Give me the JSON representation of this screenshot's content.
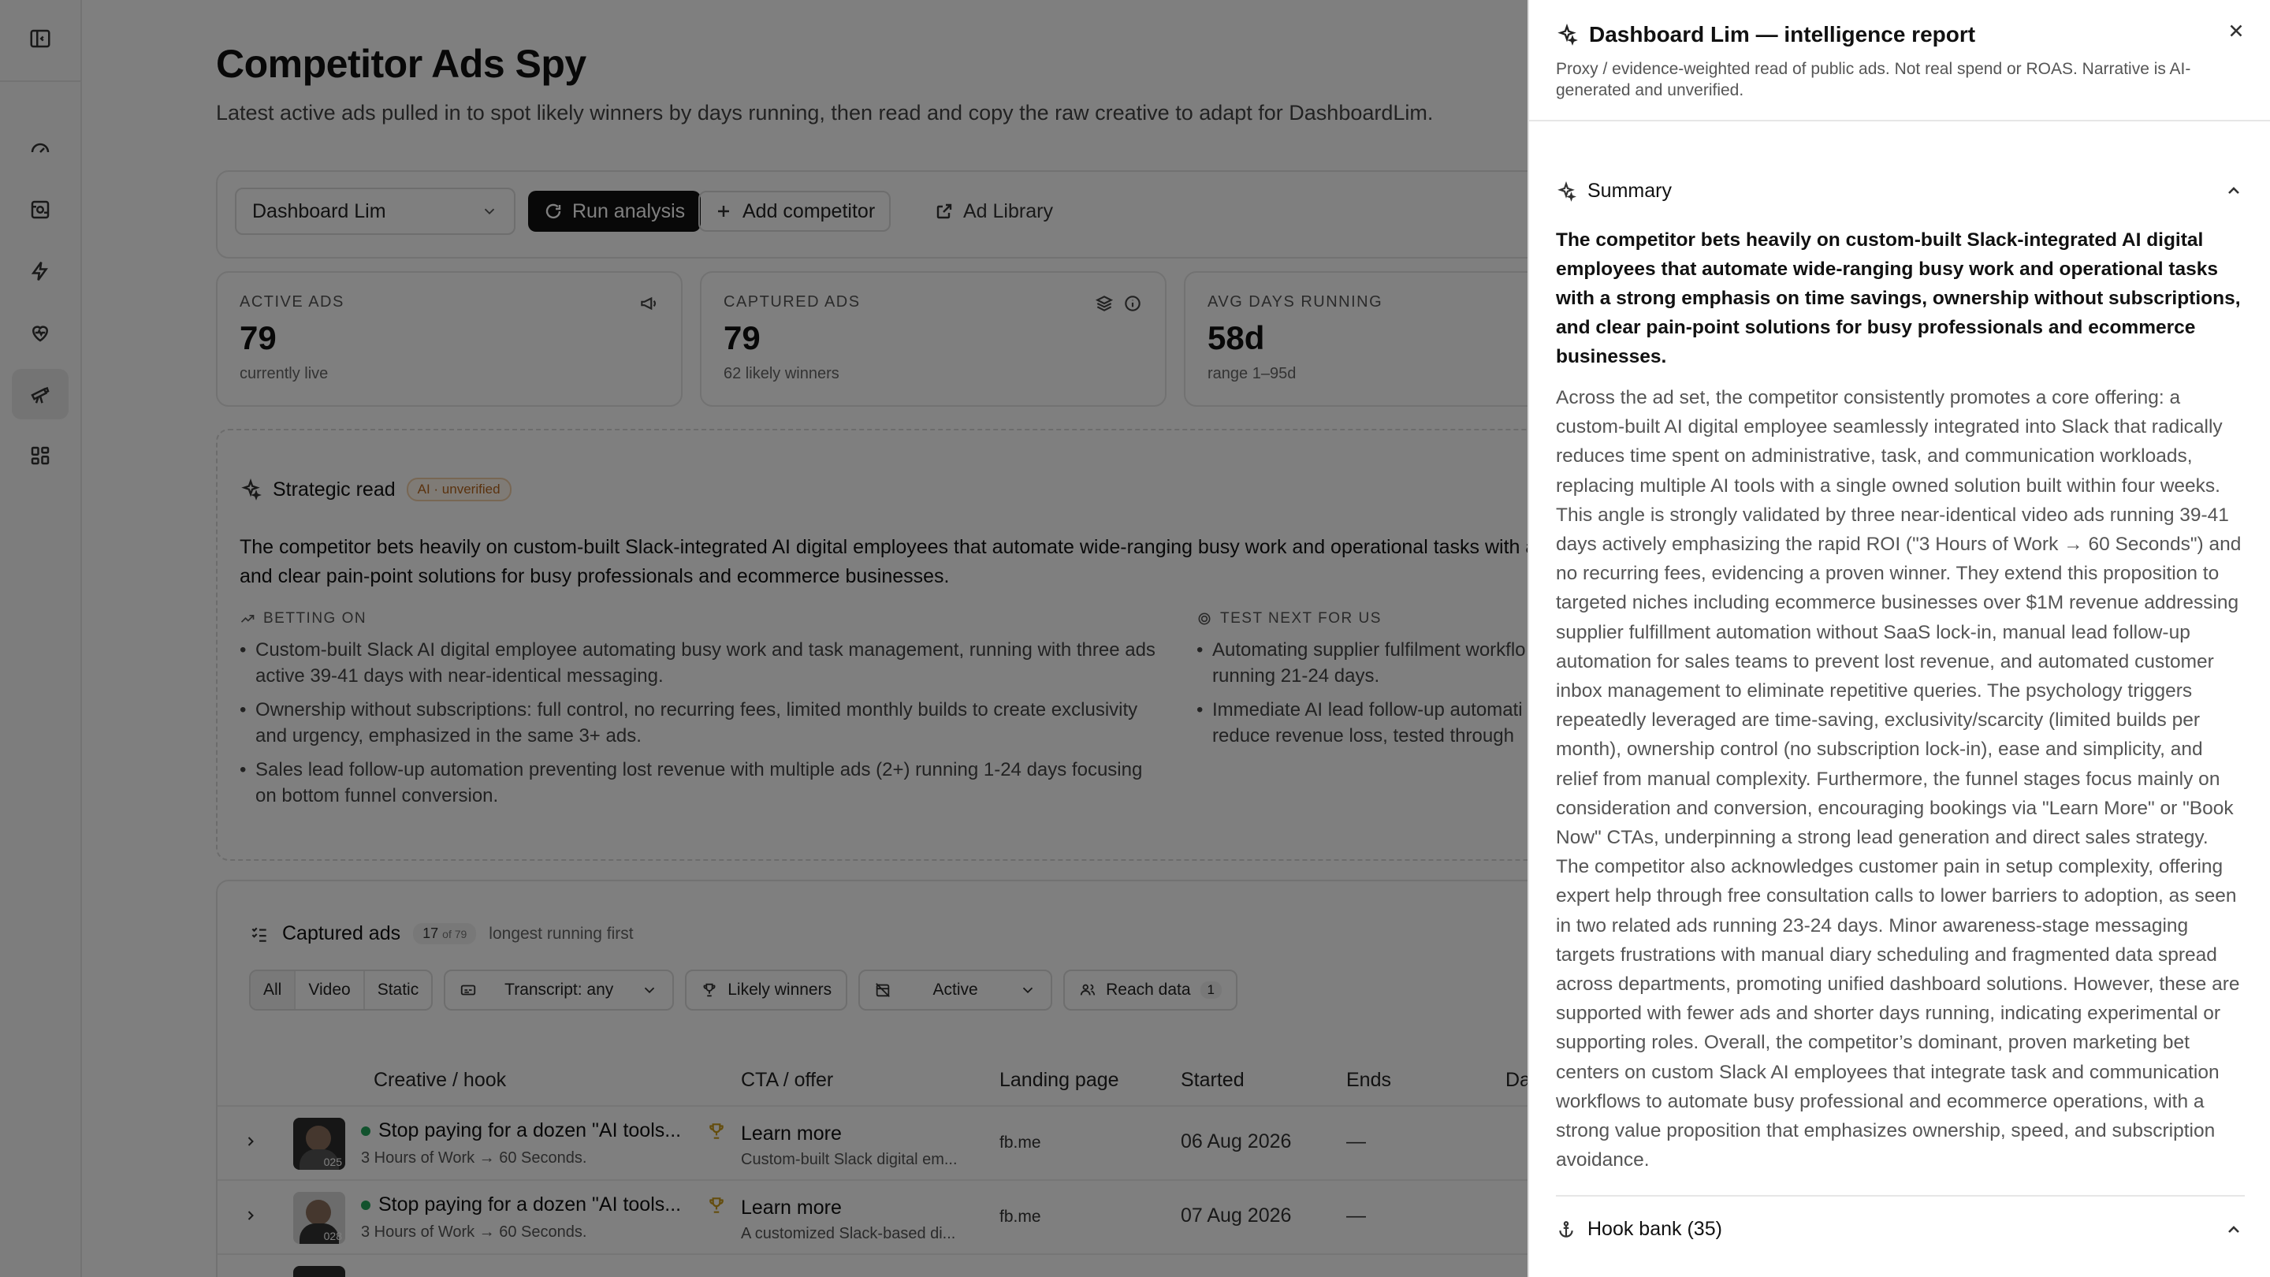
{
  "page": {
    "title": "Competitor Ads Spy",
    "subtitle": "Latest active ads pulled in to spot likely winners by days running, then read and copy the raw creative to adapt for DashboardLim."
  },
  "toolbar": {
    "competitor_select": "Dashboard Lim",
    "run_label": "Run analysis",
    "add_label": "Add competitor",
    "library_label": "Ad Library"
  },
  "stats": [
    {
      "label": "ACTIVE ADS",
      "value": "79",
      "hint": "currently live"
    },
    {
      "label": "CAPTURED ADS",
      "value": "79",
      "hint": "62 likely winners"
    },
    {
      "label": "AVG DAYS RUNNING",
      "value": "58d",
      "hint": "range 1–95d"
    }
  ],
  "strategic": {
    "title": "Strategic read",
    "badge": "AI · unverified",
    "text": "The competitor bets heavily on custom-built Slack-integrated AI digital employees that automate wide-ranging busy work and operational tasks with a s",
    "text_line2": "and clear pain-point solutions for busy professionals and ecommerce businesses.",
    "betting_head": "BETTING ON",
    "betting": [
      "Custom-built Slack AI digital employee automating busy work and task management, running with three ads active 39-41 days with near-identical messaging.",
      "Ownership without subscriptions: full control, no recurring fees, limited monthly builds to create exclusivity and urgency, emphasized in the same 3+ ads.",
      "Sales lead follow-up automation preventing lost revenue with multiple ads (2+) running 1-24 days focusing on bottom funnel conversion."
    ],
    "test_head": "TEST NEXT FOR US",
    "test": [
      "Automating supplier fulfilment workflo running 21-24 days.",
      "Immediate AI lead follow-up automati reduce revenue loss, tested through"
    ]
  },
  "captured": {
    "title": "Captured ads",
    "count": "17",
    "count_of": "of 79",
    "note": "longest running first",
    "seg": [
      "All",
      "Video",
      "Static"
    ],
    "transcript": "Transcript: any",
    "winners": "Likely winners",
    "status": "Active",
    "reach": "Reach data",
    "reach_count": "1",
    "columns": [
      "Creative / hook",
      "CTA / offer",
      "Landing page",
      "Started",
      "Ends",
      "Da"
    ],
    "rows": [
      {
        "thumb": "025",
        "hook": "Stop paying for a dozen \"AI tools...",
        "sub": "3 Hours of Work → 60 Seconds.",
        "cta": "Learn more",
        "offer": "Custom-built Slack digital em...",
        "landing": "fb.me",
        "started": "06 Aug 2026",
        "ends": "—"
      },
      {
        "thumb": "028",
        "hook": "Stop paying for a dozen \"AI tools...",
        "sub": "3 Hours of Work → 60 Seconds.",
        "cta": "Learn more",
        "offer": "A customized Slack-based di...",
        "landing": "fb.me",
        "started": "07 Aug 2026",
        "ends": "—"
      }
    ]
  },
  "drawer": {
    "title": "Dashboard Lim — intelligence report",
    "desc": "Proxy / evidence-weighted read of public ads. Not real spend or ROAS. Narrative is AI-generated and unverified.",
    "summary_head": "Summary",
    "summary_lead": "The competitor bets heavily on custom-built Slack-integrated AI digital employees that automate wide-ranging busy work and operational tasks with a strong emphasis on time savings, ownership without subscriptions, and clear pain-point solutions for busy professionals and ecommerce businesses.",
    "summary_body": "Across the ad set, the competitor consistently promotes a core offering: a custom-built AI digital employee seamlessly integrated into Slack that radically reduces time spent on administrative, task, and communication workloads, replacing multiple AI tools with a single owned solution built within four weeks. This angle is strongly validated by three near-identical video ads running 39-41 days actively emphasizing the rapid ROI (\"3 Hours of Work → 60 Seconds\") and no recurring fees, evidencing a proven winner. They extend this proposition to targeted niches including ecommerce businesses over $1M revenue addressing supplier fulfillment automation without SaaS lock-in, manual lead follow-up automation for sales teams to prevent lost revenue, and automated customer inbox management to eliminate repetitive queries. The psychology triggers repeatedly leveraged are time-saving, exclusivity/scarcity (limited builds per month), ownership control (no subscription lock-in), ease and simplicity, and relief from manual complexity. Furthermore, the funnel stages focus mainly on consideration and conversion, encouraging bookings via \"Learn More\" or \"Book Now\" CTAs, underpinning a strong lead generation and direct sales strategy. The competitor also acknowledges customer pain in setup complexity, offering expert help through free consultation calls to lower barriers to adoption, as seen in two related ads running 23-24 days. Minor awareness-stage messaging targets frustrations with manual diary scheduling and fragmented data spread across departments, promoting unified dashboard solutions. However, these are supported with fewer ads and shorter days running, indicating experimental or supporting roles. Overall, the competitor’s dominant, proven marketing bet centers on custom Slack AI employees that integrate task and communication workflows to automate busy professional and ecommerce operations, with a strong value proposition that emphasizes ownership, speed, and subscription avoidance.",
    "hookbank_head": "Hook bank (35)"
  },
  "colors": {
    "overlay": "rgba(0,0,0,0.5)",
    "accent_dark": "#111111",
    "live_dot": "#22a55a",
    "badge": "#b5651d"
  },
  "icons": [
    "sidebar-toggle-icon",
    "gauge-icon",
    "scan-icon",
    "bolt-icon",
    "heart-pulse-icon",
    "telescope-icon",
    "grid-icon",
    "sparkles-icon",
    "close-icon",
    "chevron-up-icon",
    "anchor-icon"
  ]
}
